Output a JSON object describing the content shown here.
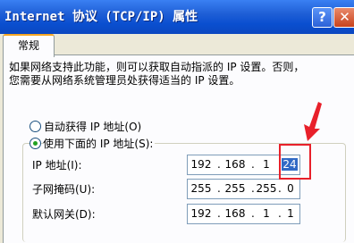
{
  "window": {
    "title": "Internet 协议 (TCP/IP) 属性",
    "help_label": "?",
    "close_label": "✕"
  },
  "tabs": [
    {
      "label": "常规",
      "active": true
    }
  ],
  "description": {
    "line1": "如果网络支持此功能，则可以获取自动指派的 IP 设置。否则，",
    "line2": "您需要从网络系统管理员处获得适当的 IP 设置。"
  },
  "ip_mode": {
    "auto_label": "自动获得 IP 地址(O)",
    "manual_label": "使用下面的 IP 地址(S):",
    "selected": "manual"
  },
  "fields": [
    {
      "label": "IP 地址(I):",
      "octets": [
        "192",
        "168",
        "1",
        "24"
      ],
      "selected_octet": 3
    },
    {
      "label": "子网掩码(U):",
      "octets": [
        "255",
        "255",
        "255",
        "0"
      ]
    },
    {
      "label": "默认网关(D):",
      "octets": [
        "192",
        "168",
        "1",
        "1"
      ]
    }
  ],
  "annotation": {
    "color": "#e8202a"
  }
}
